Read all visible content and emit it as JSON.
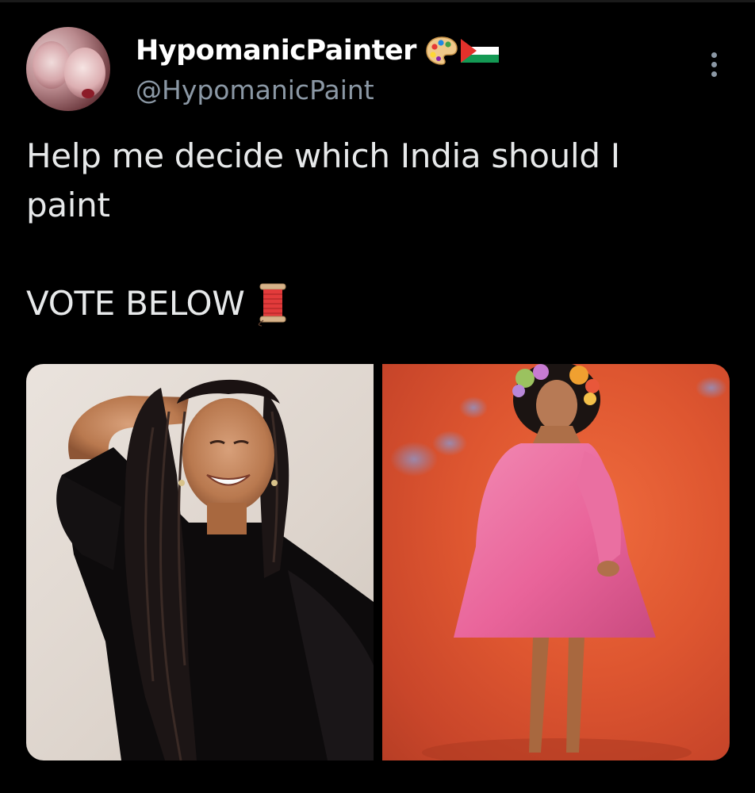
{
  "user": {
    "display_name": "HypomanicPainter",
    "handle": "@HypomanicPaint",
    "badges": [
      "artist-palette-emoji",
      "palestine-flag-emoji"
    ]
  },
  "tweet": {
    "line1": "Help me decide which India should I",
    "line2": "paint",
    "line3": "VOTE BELOW",
    "line3_emoji": "spool-of-thread-emoji"
  },
  "media": [
    {
      "name": "photo-left",
      "description": "woman with long braids in black dress laughing"
    },
    {
      "name": "photo-right",
      "description": "woman in pink dress with flower crown on orange background"
    }
  ],
  "colors": {
    "background": "#000000",
    "text_primary": "#e7e9ea",
    "text_secondary": "#8b98a5",
    "display_name": "#ffffff"
  }
}
